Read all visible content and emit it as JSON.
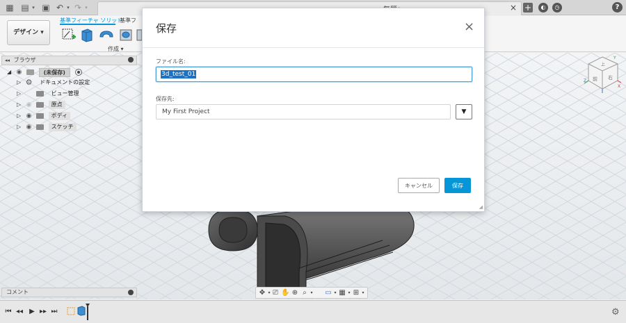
{
  "titlebar": {
    "doc_title": "無題*",
    "close_glyph": "×",
    "plus_glyph": "+",
    "help_glyph": "?"
  },
  "ribbon": {
    "workspace_label": "デザイン ▾",
    "tab_solid": "基準フィーチャ ソリッド",
    "tab_surface": "基準フ",
    "create_label": "作成 ▾"
  },
  "browser": {
    "title": "ブラウザ",
    "collapse_glyph": "◂◂",
    "root_label": "(未保存)",
    "items": [
      {
        "label": "ドキュメントの設定"
      },
      {
        "label": "ビュー管理"
      },
      {
        "label": "原点"
      },
      {
        "label": "ボディ"
      },
      {
        "label": "スケッチ"
      }
    ]
  },
  "comments": {
    "label": "コメント"
  },
  "viewcube": {
    "face_top": "上",
    "face_front": "前",
    "face_right": "右",
    "axis_x": "X",
    "axis_y": "Y",
    "axis_z": "Z"
  },
  "dialog": {
    "title": "保存",
    "close_glyph": "×",
    "filename_label": "ファイル名:",
    "filename_value": "3d_test_01",
    "location_label": "保存先:",
    "location_value": "My First Project",
    "dropdown_glyph": "▼",
    "cancel_label": "キャンセル",
    "save_label": "保存"
  },
  "colors": {
    "accent": "#0696d7",
    "selection": "#1a73c7"
  }
}
